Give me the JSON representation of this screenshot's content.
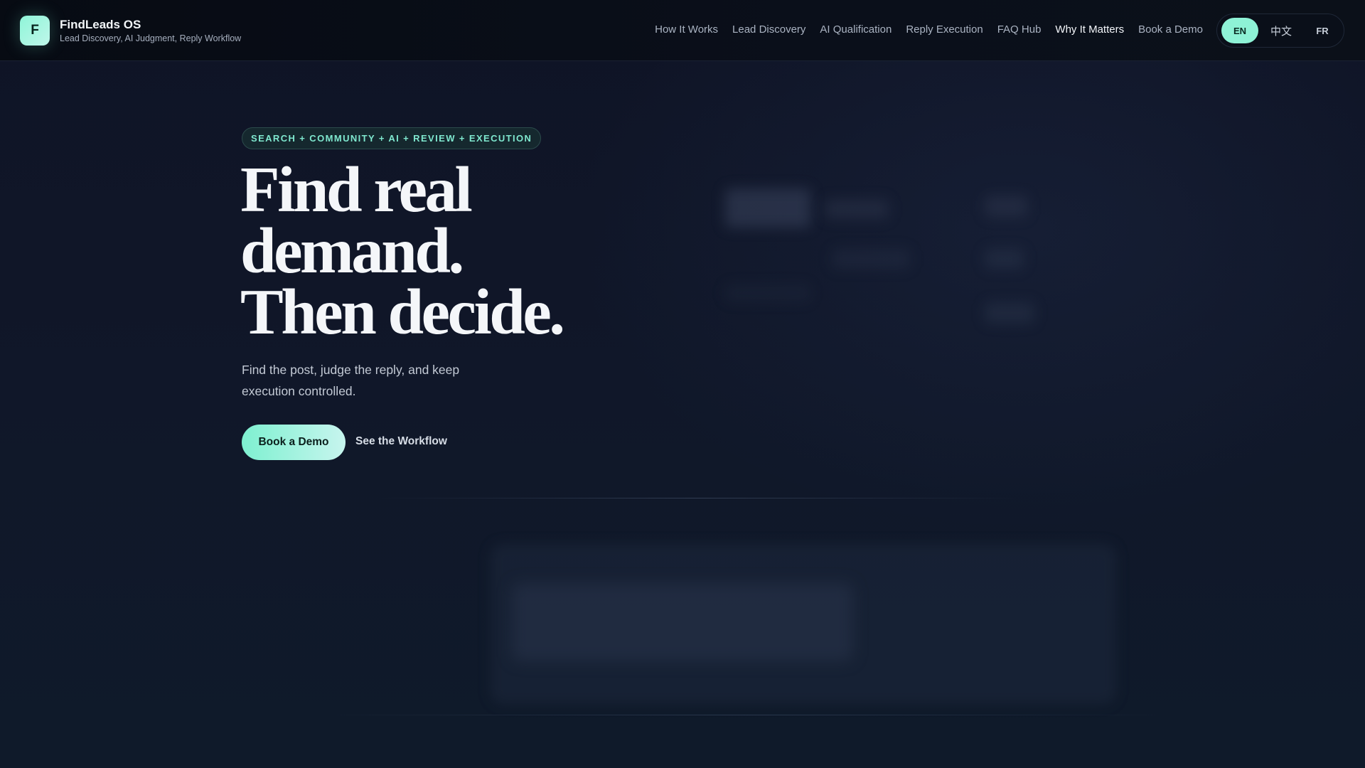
{
  "brand": {
    "logo_letter": "F",
    "name": "FindLeads OS",
    "tagline": "Lead Discovery, AI Judgment, Reply Workflow"
  },
  "nav": {
    "items": [
      {
        "label": "How It Works"
      },
      {
        "label": "Lead Discovery"
      },
      {
        "label": "AI Qualification"
      },
      {
        "label": "Reply Execution"
      },
      {
        "label": "FAQ Hub"
      },
      {
        "label": "Why It Matters",
        "active": true
      },
      {
        "label": "Book a Demo"
      }
    ]
  },
  "languages": {
    "selected": "EN",
    "options": [
      "EN",
      "中文",
      "FR"
    ]
  },
  "hero": {
    "eyebrow": "SEARCH + COMMUNITY + AI + REVIEW + EXECUTION",
    "headline": [
      "Find real",
      "demand.",
      "Then decide."
    ],
    "subtitle": "Find the post, judge the reply, and keep execution controlled.",
    "primary_cta": "Book a Demo",
    "secondary_cta": "See the Workflow"
  },
  "colors": {
    "accent": "#8ef2d6",
    "background": "#0f1426",
    "header": "#070b13"
  }
}
